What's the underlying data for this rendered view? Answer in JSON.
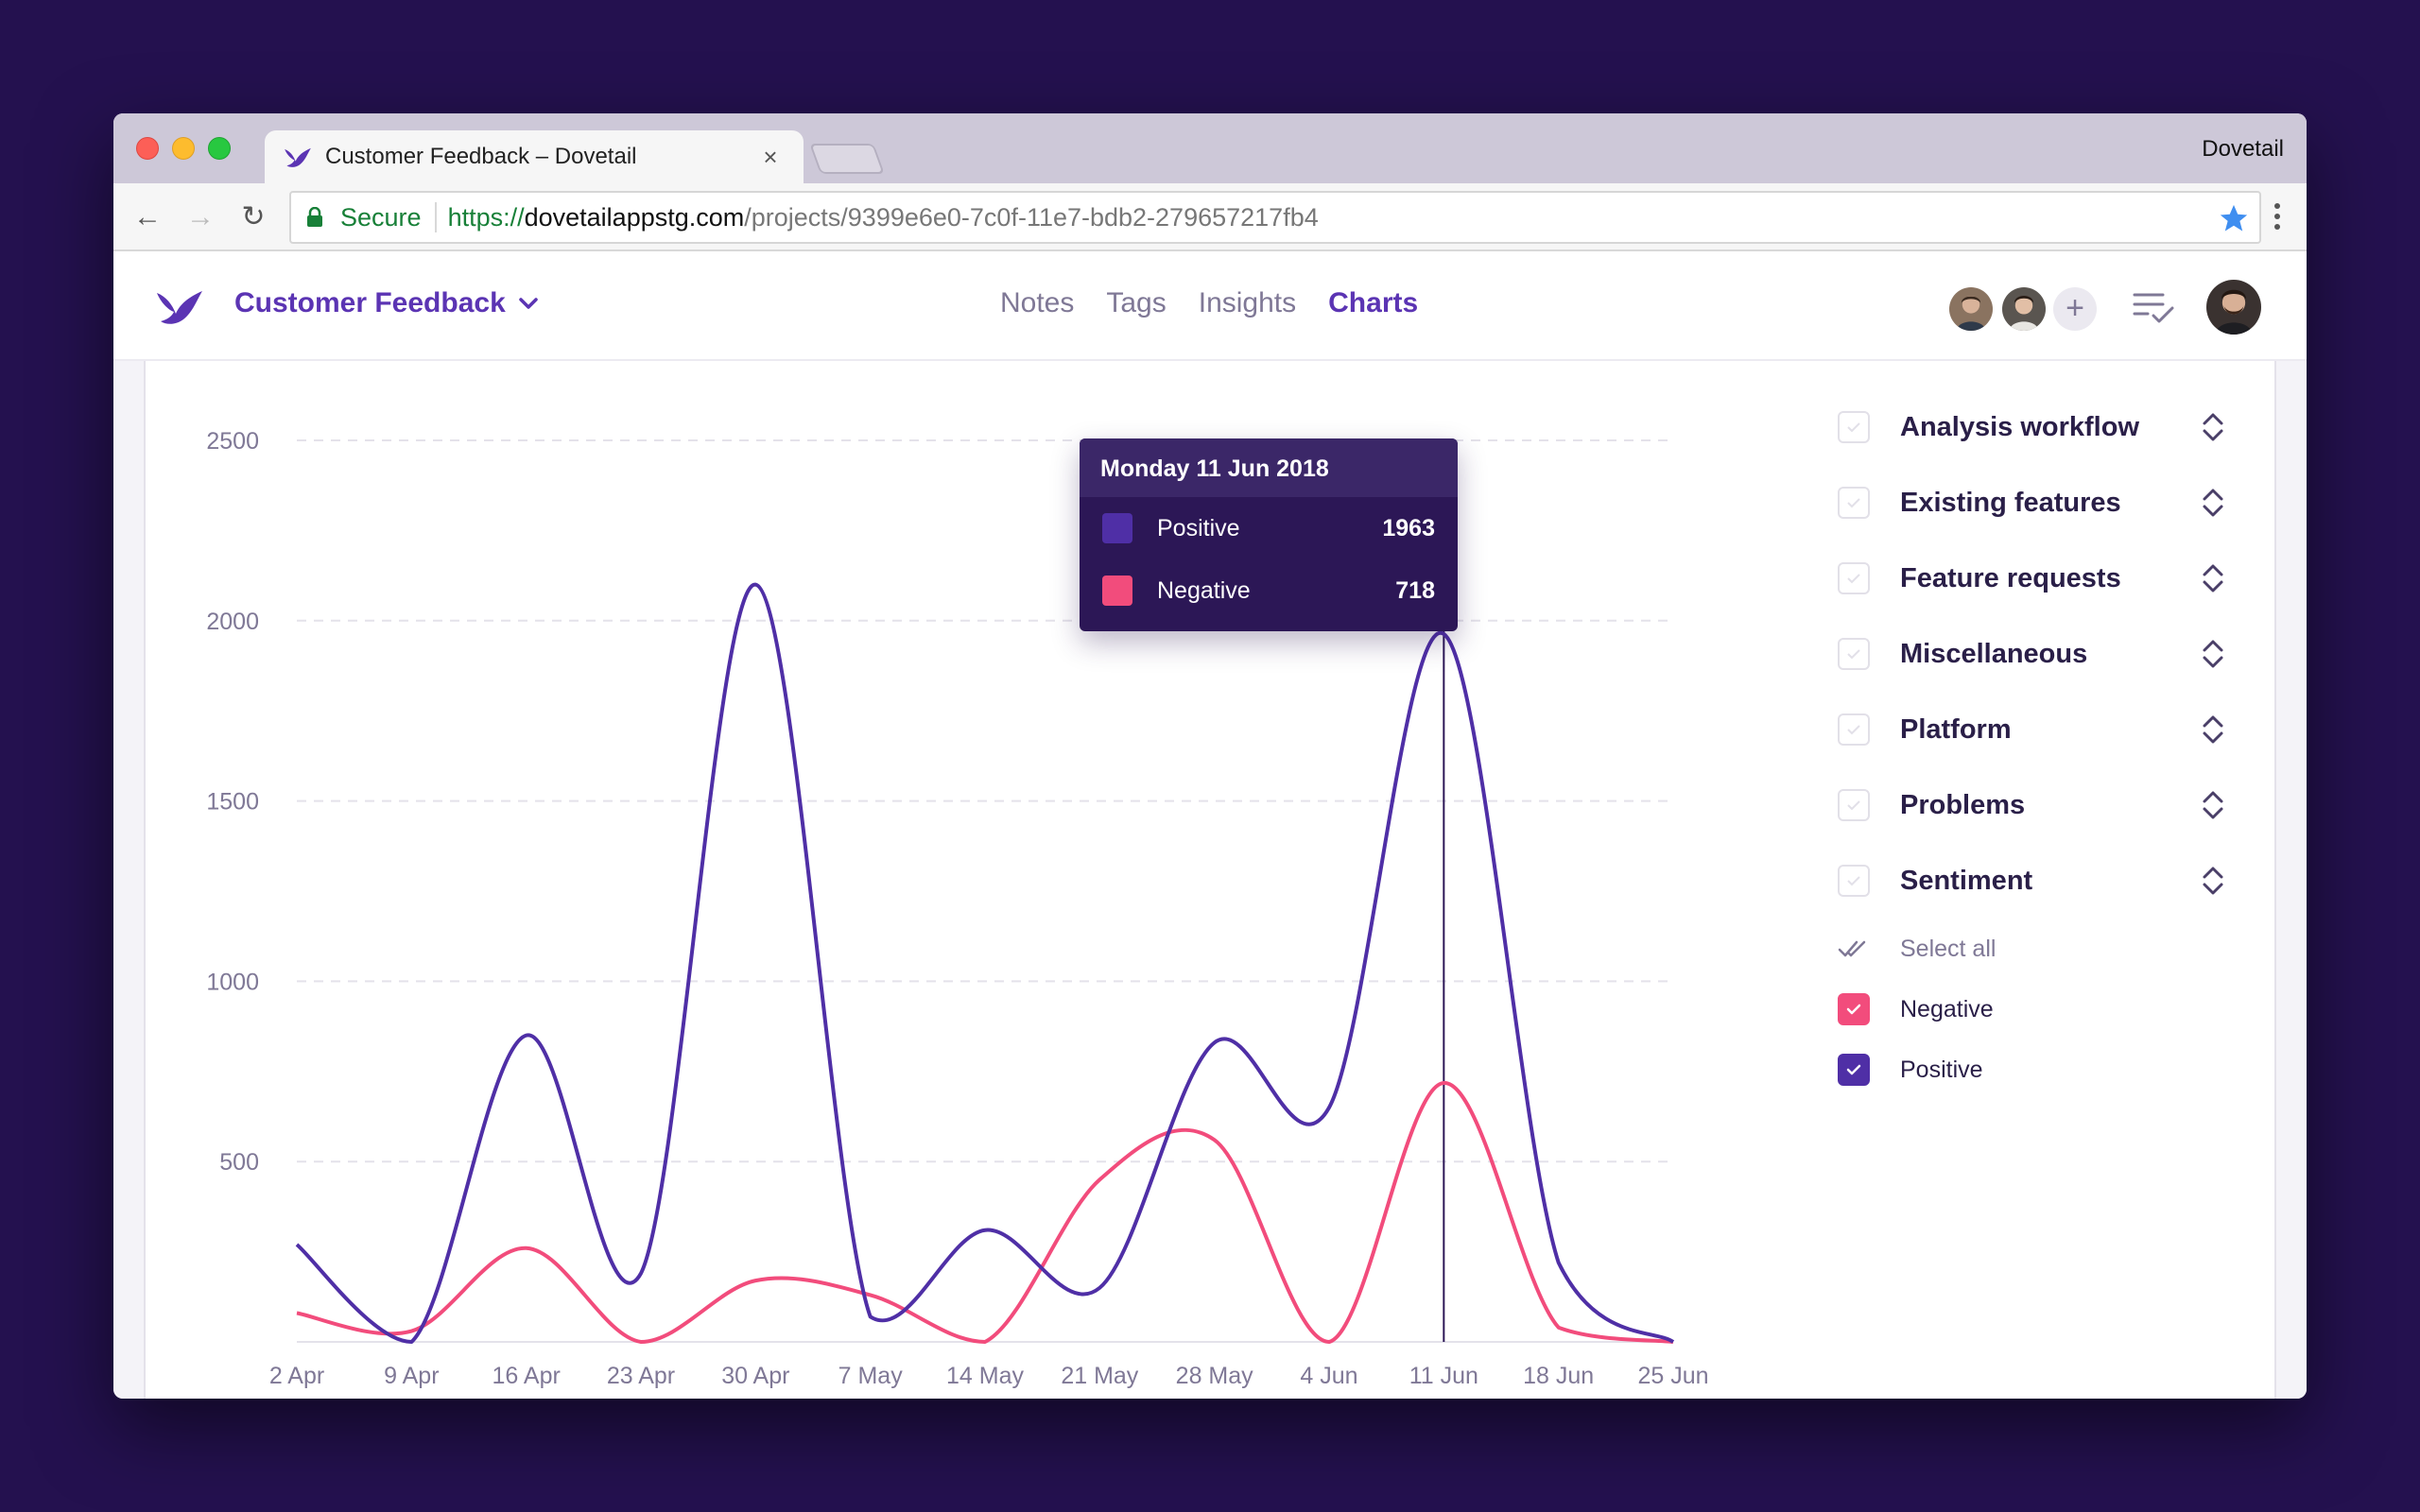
{
  "browser": {
    "tab_title": "Customer Feedback – Dovetail",
    "tab_close": "×",
    "profile_name": "Dovetail",
    "secure_label": "Secure",
    "url_scheme": "https://",
    "url_host": "dovetailappstg.com",
    "url_path": "/projects/9399e6e0-7c0f-11e7-bdb2-279657217fb4",
    "back": "←",
    "forward": "→",
    "reload": "↻"
  },
  "app": {
    "project_name": "Customer Feedback",
    "nav": [
      "Notes",
      "Tags",
      "Insights",
      "Charts"
    ],
    "active_nav": "Charts",
    "add_member": "+"
  },
  "tooltip": {
    "date": "Monday 11 Jun 2018",
    "rows": [
      {
        "label": "Positive",
        "value": "1963",
        "color": "#4f2fa6"
      },
      {
        "label": "Negative",
        "value": "718",
        "color": "#f24c7c"
      }
    ]
  },
  "filters": {
    "groups": [
      "Analysis workflow",
      "Existing features",
      "Feature requests",
      "Miscellaneous",
      "Platform",
      "Problems",
      "Sentiment"
    ],
    "select_all": "Select all",
    "options": [
      {
        "label": "Negative",
        "checked": true,
        "color": "#f24c7c"
      },
      {
        "label": "Positive",
        "checked": true,
        "color": "#4f2fa6"
      }
    ]
  },
  "colors": {
    "positive": "#4f2fa6",
    "negative": "#f24c7c",
    "brand": "#5b34b3",
    "background": "#24114f"
  },
  "chart_data": {
    "type": "line",
    "categories": [
      "2 Apr",
      "9 Apr",
      "16 Apr",
      "23 Apr",
      "30 Apr",
      "7 May",
      "14 May",
      "21 May",
      "28 May",
      "4 Jun",
      "11 Jun",
      "18 Jun",
      "25 Jun"
    ],
    "yticks": [
      "500",
      "1000",
      "1500",
      "2000",
      "2500"
    ],
    "ylim": [
      0,
      2500
    ],
    "grid": true,
    "highlight_category": "11 Jun",
    "series": [
      {
        "name": "Positive",
        "color": "#4f2fa6",
        "values": [
          270,
          0,
          850,
          190,
          2100,
          70,
          310,
          150,
          830,
          650,
          1963,
          220,
          0
        ]
      },
      {
        "name": "Negative",
        "color": "#f24c7c",
        "values": [
          80,
          30,
          260,
          0,
          170,
          130,
          0,
          450,
          560,
          0,
          718,
          40,
          0
        ]
      }
    ]
  }
}
